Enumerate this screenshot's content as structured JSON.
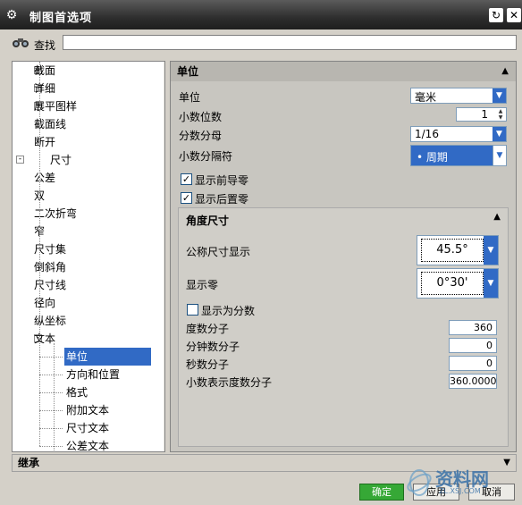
{
  "window": {
    "title": "制图首选项"
  },
  "search": {
    "label": "查找",
    "value": ""
  },
  "tree": {
    "items": [
      {
        "label": "截面",
        "level": 1,
        "expander": "+"
      },
      {
        "label": "详细",
        "level": 1,
        "expander": "+"
      },
      {
        "label": "展平图样",
        "level": 1,
        "expander": "+"
      },
      {
        "label": "截面线",
        "level": 1,
        "expander": ""
      },
      {
        "label": "断开",
        "level": 1,
        "expander": ""
      },
      {
        "label": "尺寸",
        "level": 0,
        "expander": "-"
      },
      {
        "label": "公差",
        "level": 1,
        "expander": ""
      },
      {
        "label": "双",
        "level": 1,
        "expander": ""
      },
      {
        "label": "二次折弯",
        "level": 1,
        "expander": ""
      },
      {
        "label": "窄",
        "level": 1,
        "expander": ""
      },
      {
        "label": "尺寸集",
        "level": 1,
        "expander": ""
      },
      {
        "label": "倒斜角",
        "level": 1,
        "expander": ""
      },
      {
        "label": "尺寸线",
        "level": 1,
        "expander": ""
      },
      {
        "label": "径向",
        "level": 1,
        "expander": ""
      },
      {
        "label": "纵坐标",
        "level": 1,
        "expander": ""
      },
      {
        "label": "文本",
        "level": 1,
        "expander": "-"
      },
      {
        "label": "单位",
        "level": 2,
        "expander": "",
        "selected": true
      },
      {
        "label": "方向和位置",
        "level": 2,
        "expander": ""
      },
      {
        "label": "格式",
        "level": 2,
        "expander": ""
      },
      {
        "label": "附加文本",
        "level": 2,
        "expander": ""
      },
      {
        "label": "尺寸文本",
        "level": 2,
        "expander": ""
      },
      {
        "label": "公差文本",
        "level": 2,
        "expander": ""
      }
    ]
  },
  "units_section": {
    "header": "单位",
    "unit_label": "单位",
    "unit_value": "毫米",
    "decimals_label": "小数位数",
    "decimals_value": "1",
    "fraction_label": "分数分母",
    "fraction_value": "1/16",
    "separator_label": "小数分隔符",
    "separator_value": "• 周期",
    "leading_zero_label": "显示前导零",
    "leading_zero_checked": true,
    "trailing_zero_label": "显示后置零",
    "trailing_zero_checked": true
  },
  "angle_section": {
    "header": "角度尺寸",
    "nominal_label": "公称尺寸显示",
    "nominal_value": "45.5°",
    "zero_label": "显示零",
    "zero_value": "0°30'",
    "fraction_display_label": "显示为分数",
    "fraction_display_checked": false,
    "deg_num_label": "度数分子",
    "deg_num_value": "360",
    "min_num_label": "分钟数分子",
    "min_num_value": "0",
    "sec_num_label": "秒数分子",
    "sec_num_value": "0",
    "dec_deg_label": "小数表示度数分子",
    "dec_deg_value": "360.00000"
  },
  "inherit": {
    "label": "继承"
  },
  "buttons": {
    "ok": "确定",
    "apply": "应用",
    "cancel": "取消"
  },
  "watermark": {
    "text": "资料网",
    "url": "ZL.XSJ.COM"
  },
  "colors": {
    "accent": "#316ac5",
    "ok_green": "#36a836",
    "title_dark": "#2e2e2e"
  }
}
